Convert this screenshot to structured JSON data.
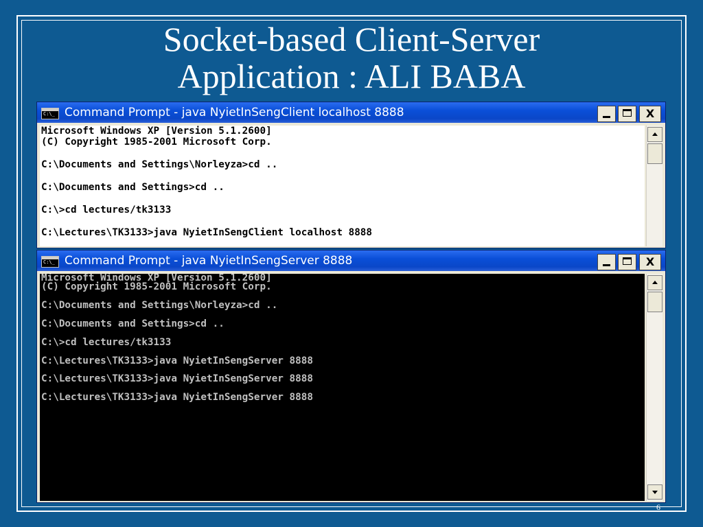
{
  "slide": {
    "title_line1": "Socket-based Client-Server",
    "title_line2": "Application : ALI BABA",
    "page_number": "6"
  },
  "colors": {
    "background": "#0e5a92",
    "titlebar": "#0a4fd8",
    "client_console_bg": "#ffffff",
    "server_console_bg": "#000000",
    "server_text": "#c0c0c0"
  },
  "icons": {
    "window_icon": "cmd-icon",
    "minimize": "minimize-icon",
    "maximize": "maximize-icon",
    "close": "close-icon"
  },
  "client_window": {
    "title": "Command Prompt - java NyietInSengClient localhost 8888",
    "lines": [
      "Microsoft Windows XP [Version 5.1.2600]",
      "(C) Copyright 1985-2001 Microsoft Corp.",
      "",
      "C:\\Documents and Settings\\Norleyza>cd ..",
      "",
      "C:\\Documents and Settings>cd ..",
      "",
      "C:\\>cd lectures/tk3133",
      "",
      "C:\\Lectures\\TK3133>java NyietInSengClient localhost 8888"
    ]
  },
  "server_window": {
    "title": "Command Prompt - java NyietInSengServer 8888",
    "lines": [
      "Microsoft Windows XP [Version 5.1.2600]",
      "(C) Copyright 1985-2001 Microsoft Corp.",
      "",
      "C:\\Documents and Settings\\Norleyza>cd ..",
      "",
      "C:\\Documents and Settings>cd ..",
      "",
      "C:\\>cd lectures/tk3133",
      "",
      "C:\\Lectures\\TK3133>java NyietInSengServer 8888",
      "",
      "C:\\Lectures\\TK3133>java NyietInSengServer 8888",
      "",
      "C:\\Lectures\\TK3133>java NyietInSengServer 8888"
    ]
  },
  "buttons": {
    "close": "X"
  }
}
